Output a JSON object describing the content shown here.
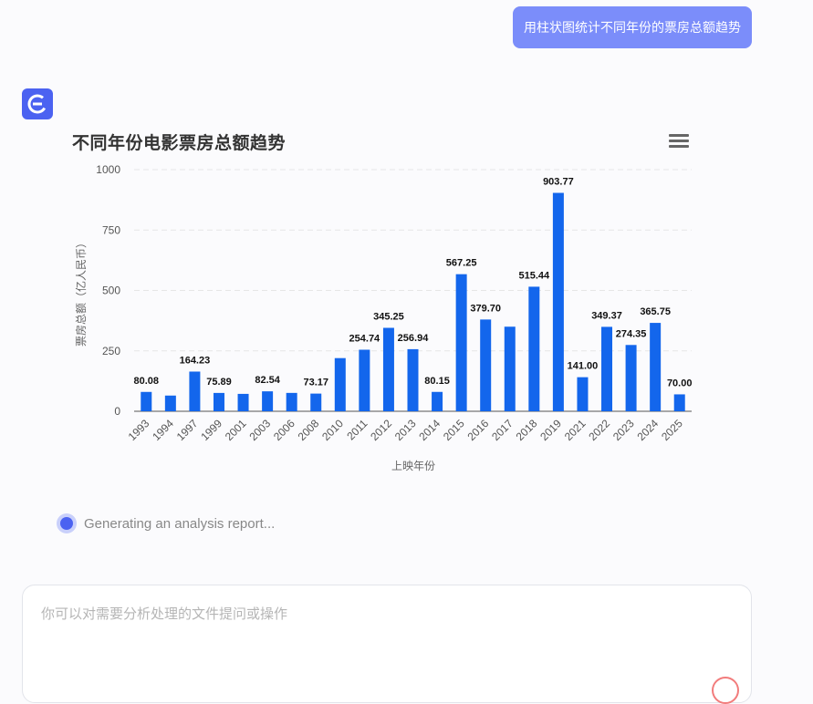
{
  "user_message": "用柱状图统计不同年份的票房总额趋势",
  "chart_data": {
    "type": "bar",
    "title": "不同年份电影票房总额趋势",
    "xlabel": "上映年份",
    "ylabel": "票房总额（亿人民币）",
    "ylim": [
      0,
      1000
    ],
    "yticks": [
      0,
      250,
      500,
      750,
      1000
    ],
    "grid": true,
    "categories": [
      "1993",
      "1994",
      "1997",
      "1999",
      "2001",
      "2003",
      "2006",
      "2008",
      "2010",
      "2011",
      "2012",
      "2013",
      "2014",
      "2015",
      "2016",
      "2017",
      "2018",
      "2019",
      "2021",
      "2022",
      "2023",
      "2024",
      "2025"
    ],
    "values": [
      80.08,
      65,
      164.23,
      75.89,
      72,
      82.54,
      76,
      73.17,
      220,
      254.74,
      345.25,
      256.94,
      80.15,
      567.25,
      379.7,
      350,
      515.44,
      903.77,
      141.0,
      349.37,
      274.35,
      365.75,
      70.0
    ],
    "value_labels": [
      "80.08",
      "",
      "164.23",
      "75.89",
      "",
      "82.54",
      "",
      "73.17",
      "",
      "254.74",
      "345.25",
      "256.94",
      "80.15",
      "567.25",
      "379.70",
      "",
      "515.44",
      "903.77",
      "141.00",
      "349.37",
      "274.35",
      "365.75",
      "70.00"
    ],
    "bar_color": "#1366ec"
  },
  "status": {
    "text": "Generating an analysis report..."
  },
  "input": {
    "placeholder": "你可以对需要分析处理的文件提问或操作"
  },
  "colors": {
    "accent": "#4b62f1",
    "user_bubble": "#7b8dfa"
  }
}
